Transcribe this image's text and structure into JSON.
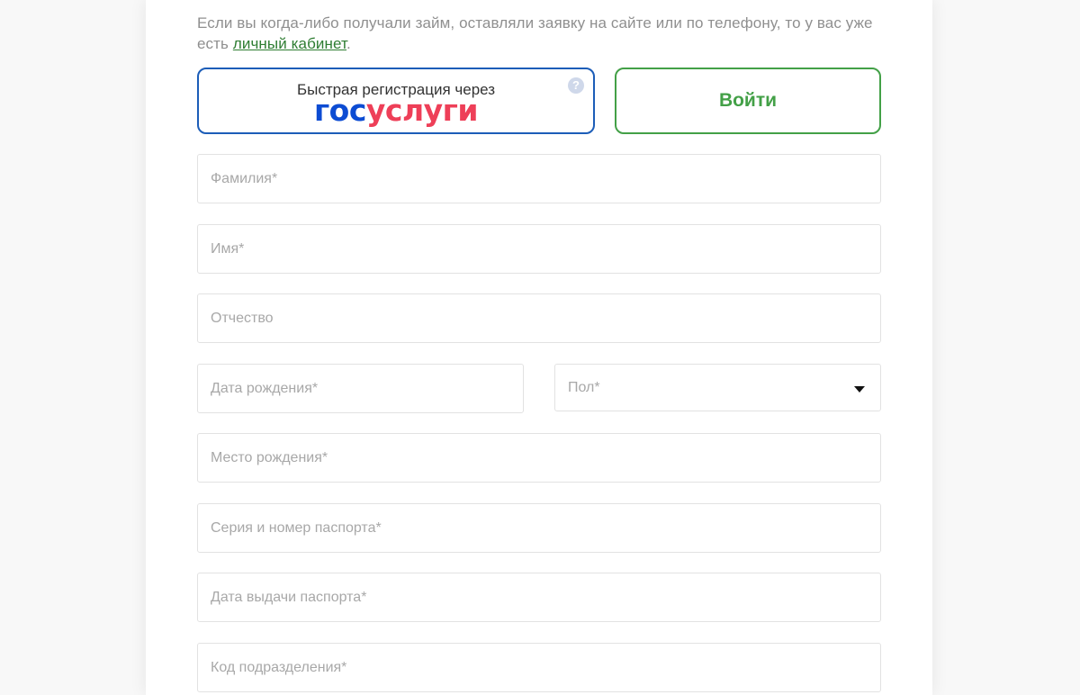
{
  "intro": {
    "text_before_link": "Если вы когда-либо получали займ, оставляли заявку на сайте или по телефону, то у вас уже есть ",
    "link_text": "личный кабинет",
    "text_after_link": "."
  },
  "gosuslugi_button": {
    "caption": "Быстрая регистрация через",
    "logo_part_1": "гос",
    "logo_part_2": "услуги",
    "help_icon": "?"
  },
  "login_button": {
    "label": "Войти"
  },
  "form": {
    "last_name_placeholder": "Фамилия*",
    "first_name_placeholder": "Имя*",
    "middle_name_placeholder": "Отчество",
    "birth_date_placeholder": "Дата рождения*",
    "gender_placeholder": "Пол*",
    "birth_place_placeholder": "Место рождения*",
    "passport_number_placeholder": "Серия и номер паспорта*",
    "passport_issue_date_placeholder": "Дата выдачи паспорта*",
    "division_code_placeholder": "Код подразделения*"
  },
  "colors": {
    "gosuslugi_blue": "#0d4cd3",
    "gosuslugi_red": "#ee3f58",
    "brand_green": "#43a047",
    "link_green": "#2e7d32"
  }
}
